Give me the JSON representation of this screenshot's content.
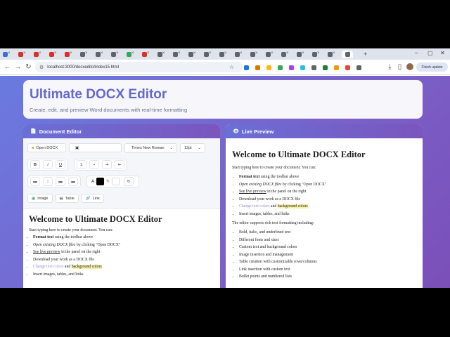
{
  "browser": {
    "tabs": [
      {
        "color": "#3b6fd8",
        "label": "G"
      },
      {
        "color": "#d93025",
        "label": ""
      },
      {
        "color": "#d93025",
        "label": ""
      },
      {
        "color": "#d93025",
        "label": ""
      },
      {
        "color": "#d93025",
        "label": ""
      },
      {
        "color": "#5f6368",
        "label": ""
      },
      {
        "color": "#5f6368",
        "label": ""
      },
      {
        "color": "#5f6368",
        "label": ""
      },
      {
        "color": "#34a853",
        "label": ""
      },
      {
        "color": "#d93025",
        "label": ""
      },
      {
        "color": "#5f6368",
        "label": ""
      },
      {
        "color": "#5f6368",
        "label": ""
      },
      {
        "color": "#5f6368",
        "label": ""
      },
      {
        "color": "#5f6368",
        "label": ""
      },
      {
        "color": "#5f6368",
        "label": ""
      },
      {
        "color": "#5f6368",
        "label": ""
      },
      {
        "color": "#5f6368",
        "label": ""
      },
      {
        "color": "#5f6368",
        "label": ""
      },
      {
        "color": "#5f6368",
        "label": ""
      },
      {
        "color": "#5f6368",
        "label": ""
      },
      {
        "color": "#5f6368",
        "label": ""
      },
      {
        "color": "#5f6368",
        "label": ""
      },
      {
        "color": "#5f6368",
        "label": ""
      }
    ],
    "new_tab": "+",
    "url": "localhost:3000/docxedito/index15.html",
    "finish_update": "Finish update",
    "extension_colors": [
      "#1a73e8",
      "#e37400",
      "#fbbc04",
      "#34a853",
      "#a142f4",
      "#24c1e0",
      "#5f6368",
      "#188038",
      "#f29900",
      "#ea4335",
      "#5f6368"
    ]
  },
  "header": {
    "title": "Ultimate DOCX Editor",
    "subtitle": "Create, edit, and preview Word documents with real-time formatting"
  },
  "editor": {
    "heading": "Document Editor",
    "open_docx": "Open DOCX",
    "font_family": "Times New Roman",
    "font_size": "12pt",
    "bold": "B",
    "italic": "I",
    "underline": "U",
    "ordered_list": "1.",
    "unordered_list": "•",
    "indent": "⇥",
    "outdent": "⇤",
    "text_color_label": "A",
    "insert_image": "Image",
    "insert_table": "Table",
    "insert_link": "Link",
    "colors": {
      "text": "#000000",
      "highlight": "#ffffff"
    }
  },
  "document": {
    "title": "Welcome to Ultimate DOCX Editor",
    "intro": "Start typing here to create your document. You can:",
    "items": [
      {
        "strong": "Format text",
        "rest": " using the toolbar above"
      },
      {
        "em": "Open existing DOCX files",
        "rest": " by clicking \"Open DOCX\""
      },
      {
        "u": "See live preview",
        "rest": " in the panel on the right"
      },
      {
        "plain": "Download your work as a DOCX file"
      },
      {
        "colored": "Change text colors",
        "mid": " and ",
        "bg": "background colors"
      },
      {
        "plain": "Insert images, tables, and links"
      }
    ]
  },
  "preview": {
    "heading": "Live Preview",
    "title": "Welcome to Ultimate DOCX Editor",
    "intro": "Start typing here to create your document. You can:",
    "items": [
      {
        "strong": "Format text",
        "rest": " using the toolbar above"
      },
      {
        "em": "Open existing DOCX files",
        "rest": " by clicking \"Open DOCX\""
      },
      {
        "u": "See live preview",
        "rest": " in the panel on the right"
      },
      {
        "plain": "Download your work as a DOCX file"
      },
      {
        "colored": "Change text colors",
        "mid": " and ",
        "bg": "background colors"
      },
      {
        "plain": "Insert images, tables, and links"
      }
    ],
    "support_text": "The editor supports rich text formatting including:",
    "features": [
      "Bold, italic, and underlined text",
      "Different fonts and sizes",
      "Custom text and background colors",
      "Image insertion and management",
      "Table creation with customizable rows/columns",
      "Link insertion with custom text",
      "Bullet points and numbered lists"
    ]
  }
}
